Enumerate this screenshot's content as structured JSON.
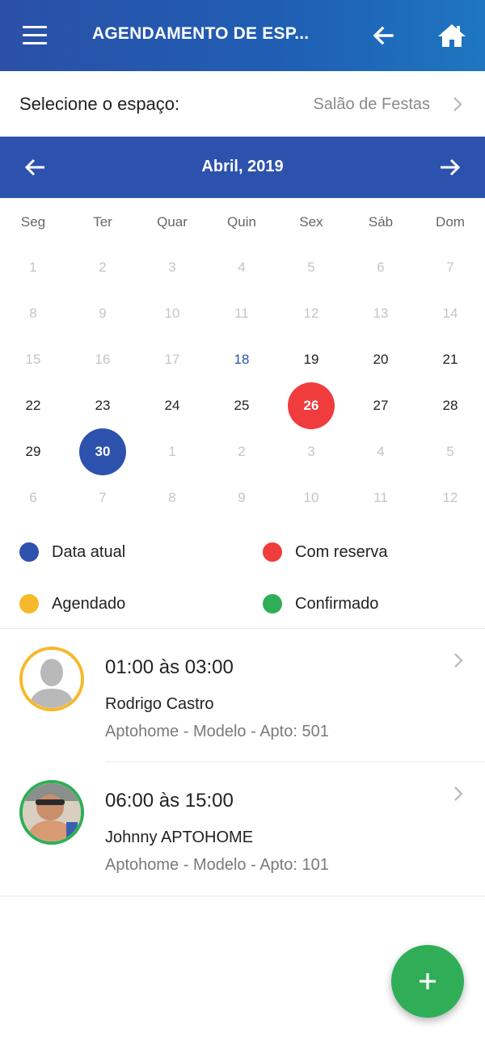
{
  "header": {
    "title": "AGENDAMENTO DE ESP...",
    "icons": [
      "menu-icon",
      "arrow-left-icon",
      "home-icon"
    ]
  },
  "space": {
    "label": "Selecione o espaço:",
    "value": "Salão de Festas"
  },
  "calendar": {
    "month": "Abril, 2019",
    "weekdays": [
      "Seg",
      "Ter",
      "Quar",
      "Quin",
      "Sex",
      "Sáb",
      "Dom"
    ],
    "weeks": [
      [
        {
          "d": "1",
          "s": "muted"
        },
        {
          "d": "2",
          "s": "muted"
        },
        {
          "d": "3",
          "s": "muted"
        },
        {
          "d": "4",
          "s": "muted"
        },
        {
          "d": "5",
          "s": "muted"
        },
        {
          "d": "6",
          "s": "muted"
        },
        {
          "d": "7",
          "s": "muted"
        }
      ],
      [
        {
          "d": "8",
          "s": "muted"
        },
        {
          "d": "9",
          "s": "muted"
        },
        {
          "d": "10",
          "s": "muted"
        },
        {
          "d": "11",
          "s": "muted"
        },
        {
          "d": "12",
          "s": "muted"
        },
        {
          "d": "13",
          "s": "muted"
        },
        {
          "d": "14",
          "s": "muted"
        }
      ],
      [
        {
          "d": "15",
          "s": "muted"
        },
        {
          "d": "16",
          "s": "muted"
        },
        {
          "d": "17",
          "s": "muted"
        },
        {
          "d": "18",
          "s": "today-text"
        },
        {
          "d": "19",
          "s": "normal"
        },
        {
          "d": "20",
          "s": "normal"
        },
        {
          "d": "21",
          "s": "normal"
        }
      ],
      [
        {
          "d": "22",
          "s": "normal"
        },
        {
          "d": "23",
          "s": "normal"
        },
        {
          "d": "24",
          "s": "normal"
        },
        {
          "d": "25",
          "s": "normal"
        },
        {
          "d": "26",
          "s": "reserved"
        },
        {
          "d": "27",
          "s": "normal"
        },
        {
          "d": "28",
          "s": "normal"
        }
      ],
      [
        {
          "d": "29",
          "s": "normal"
        },
        {
          "d": "30",
          "s": "current"
        },
        {
          "d": "1",
          "s": "muted"
        },
        {
          "d": "2",
          "s": "muted"
        },
        {
          "d": "3",
          "s": "muted"
        },
        {
          "d": "4",
          "s": "muted"
        },
        {
          "d": "5",
          "s": "muted"
        }
      ],
      [
        {
          "d": "6",
          "s": "muted"
        },
        {
          "d": "7",
          "s": "muted"
        },
        {
          "d": "8",
          "s": "muted"
        },
        {
          "d": "9",
          "s": "muted"
        },
        {
          "d": "10",
          "s": "muted"
        },
        {
          "d": "11",
          "s": "muted"
        },
        {
          "d": "12",
          "s": "muted"
        }
      ]
    ]
  },
  "legend": {
    "current": {
      "label": "Data atual",
      "color": "#2c52ad"
    },
    "reserved": {
      "label": "Com reserva",
      "color": "#f03c3c"
    },
    "scheduled": {
      "label": "Agendado",
      "color": "#f6b92b"
    },
    "confirmed": {
      "label": "Confirmado",
      "color": "#2fae57"
    }
  },
  "bookings": [
    {
      "time": "01:00 às 03:00",
      "name": "Rodrigo Castro",
      "place": "Aptohome - Modelo - Apto: 501",
      "status_color": "#f6b92b",
      "avatar": "placeholder-avatar"
    },
    {
      "time": "06:00 às 15:00",
      "name": "Johnny APTOHOME",
      "place": "Aptohome - Modelo - Apto: 101",
      "status_color": "#2fae57",
      "avatar": "photo-avatar"
    }
  ],
  "fab": {
    "icon": "plus-icon"
  }
}
